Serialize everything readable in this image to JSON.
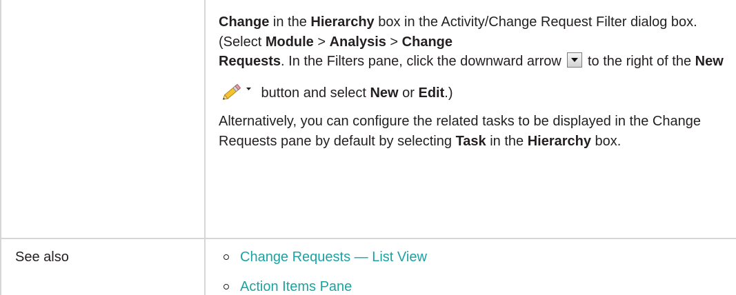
{
  "description": {
    "p1": {
      "t1": "Change",
      "t2": " in the ",
      "t3": "Hierarchy",
      "t4": " box in the Activity/Change Request Filter dialog box. (Select ",
      "t5": "Module",
      "t6": " > ",
      "t7": "Analysis",
      "t8": " > ",
      "t9": "Change Requests",
      "t10": ". In the Filters pane, click the downward arrow ",
      "t11": " to the right of the ",
      "t12": "New",
      "t13": " button and select ",
      "t14": "New",
      "t15": " or ",
      "t16": "Edit",
      "t17": ".)"
    },
    "p2": {
      "t1": "Alternatively, you can configure the related tasks to be displayed in the Change Requests pane by default by selecting ",
      "t2": "Task",
      "t3": " in the ",
      "t4": "Hierarchy",
      "t5": " box."
    }
  },
  "see_also": {
    "label": "See also",
    "links": [
      {
        "label": "Change Requests — List View"
      },
      {
        "label": "Action Items Pane"
      }
    ]
  },
  "colors": {
    "text": "#231f20",
    "link": "#1aa3a3",
    "border": "#d6d6d6"
  },
  "icons": [
    "dropdown-arrow-icon",
    "pencil-icon",
    "chevron-down-icon"
  ]
}
